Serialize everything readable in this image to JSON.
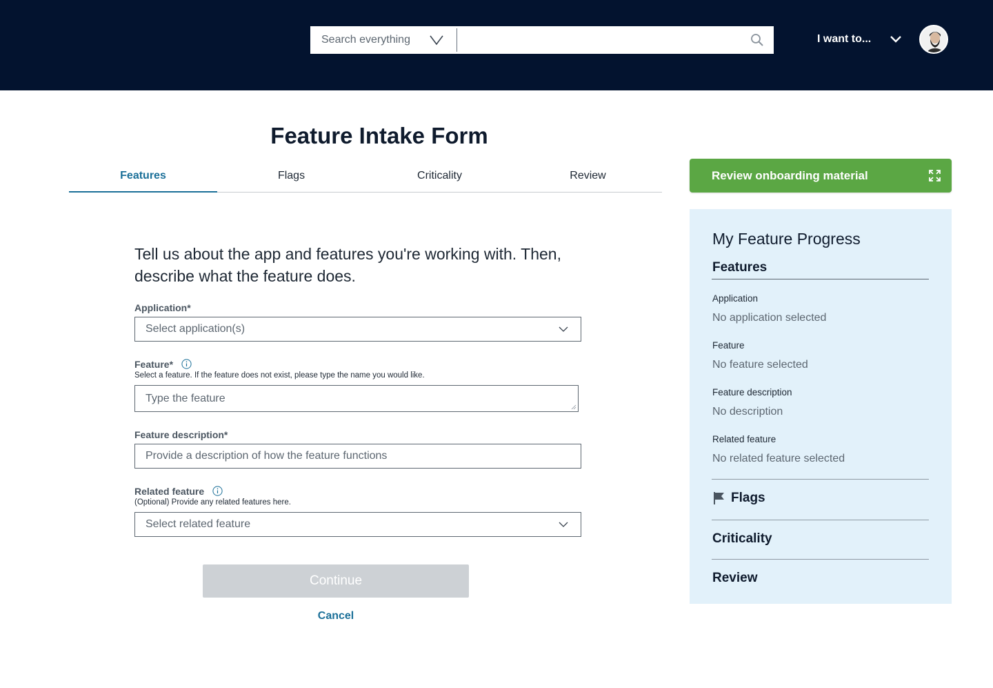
{
  "header": {
    "search_scope_label": "Search everything",
    "search_placeholder": "",
    "menu_label": "I want to..."
  },
  "page": {
    "title": "Feature Intake Form"
  },
  "tabs": [
    {
      "label": "Features",
      "active": true
    },
    {
      "label": "Flags",
      "active": false
    },
    {
      "label": "Criticality",
      "active": false
    },
    {
      "label": "Review",
      "active": false
    }
  ],
  "form": {
    "intro": "Tell us about the app and features you're working with. Then, describe what the feature does.",
    "application": {
      "label": "Application*",
      "placeholder": "Select application(s)"
    },
    "feature": {
      "label": "Feature*",
      "hint": "Select a feature. If the feature does not exist, please type the name you would like.",
      "placeholder": "Type the feature"
    },
    "description": {
      "label": "Feature description*",
      "placeholder": "Provide a description of how the feature functions"
    },
    "related": {
      "label": "Related feature",
      "hint": "(Optional) Provide any related features here.",
      "placeholder": "Select related feature"
    },
    "continue_label": "Continue",
    "cancel_label": "Cancel"
  },
  "sidebar": {
    "onboarding_label": "Review onboarding material",
    "progress_title": "My Feature Progress",
    "features_heading": "Features",
    "items": [
      {
        "label": "Application",
        "value": "No application selected"
      },
      {
        "label": "Feature",
        "value": "No feature selected"
      },
      {
        "label": "Feature description",
        "value": "No description"
      },
      {
        "label": "Related feature",
        "value": "No related feature selected"
      }
    ],
    "flags_heading": "Flags",
    "criticality_heading": "Criticality",
    "review_heading": "Review"
  },
  "colors": {
    "header_bg": "#03132f",
    "accent": "#1a6f98",
    "onboarding_green": "#5ba744",
    "progress_bg": "#e2f1fa",
    "disabled_button": "#cdd1d5"
  },
  "icons": [
    "search-icon",
    "chevron-down-icon",
    "info-icon",
    "expand-icon",
    "flag-icon",
    "avatar"
  ]
}
